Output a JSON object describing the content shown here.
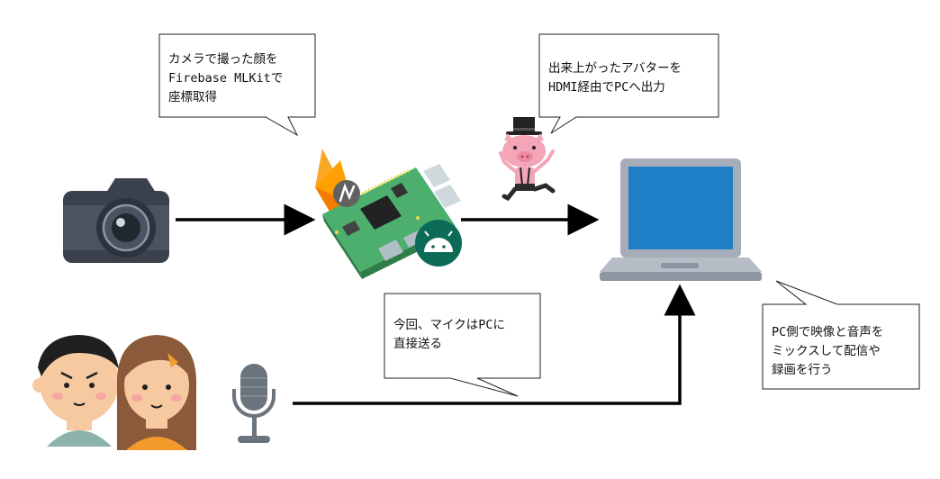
{
  "bubbles": {
    "camera_note": [
      "カメラで撮った顔を",
      "Firebase MLKitで",
      "座標取得"
    ],
    "output_note": [
      "出来上がったアバターを",
      "HDMI経由でPCへ出力"
    ],
    "mic_note": [
      "今回、マイクはPCに",
      "直接送る"
    ],
    "pc_note": [
      "PC側で映像と音声を",
      "ミックスして配信や",
      "録画を行う"
    ]
  },
  "icons": [
    "camera-icon",
    "firebase-icon",
    "mlkit-icon",
    "raspberry-pi-board-icon",
    "android-icon",
    "pig-avatar-icon",
    "laptop-icon",
    "microphone-icon",
    "boy-icon",
    "girl-icon"
  ]
}
